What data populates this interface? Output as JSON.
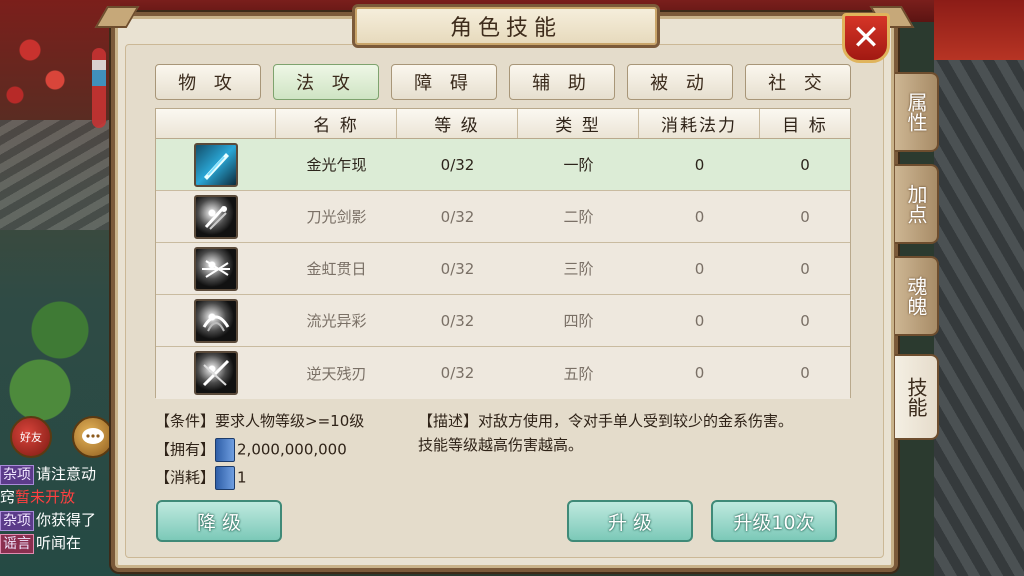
{
  "window": {
    "title": "角色技能",
    "close_icon": "close-x-icon"
  },
  "category_tabs": [
    {
      "label": "物 攻",
      "active": false
    },
    {
      "label": "法 攻",
      "active": true
    },
    {
      "label": "障 碍",
      "active": false
    },
    {
      "label": "辅 助",
      "active": false
    },
    {
      "label": "被 动",
      "active": false
    },
    {
      "label": "社 交",
      "active": false
    }
  ],
  "side_tabs": [
    {
      "label": "属性",
      "active": false
    },
    {
      "label": "加点",
      "active": false
    },
    {
      "label": "魂魄",
      "active": false
    },
    {
      "label": "技能",
      "active": true
    }
  ],
  "table": {
    "headers": [
      "",
      "名 称",
      "等 级",
      "类 型",
      "消耗法力",
      "目 标"
    ],
    "rows": [
      {
        "icon": "golden-light-sword-icon",
        "name": "金光乍现",
        "level": "0/32",
        "type": "一阶",
        "mana": "0",
        "target": "0",
        "selected": true
      },
      {
        "icon": "blade-shadow-icon",
        "name": "刀光剑影",
        "level": "0/32",
        "type": "二阶",
        "mana": "0",
        "target": "0",
        "selected": false
      },
      {
        "icon": "rainbow-sword-icon",
        "name": "金虹贯日",
        "level": "0/32",
        "type": "三阶",
        "mana": "0",
        "target": "0",
        "selected": false
      },
      {
        "icon": "flowing-light-icon",
        "name": "流光异彩",
        "level": "0/32",
        "type": "四阶",
        "mana": "0",
        "target": "0",
        "selected": false
      },
      {
        "icon": "broken-blade-icon",
        "name": "逆天残刃",
        "level": "0/32",
        "type": "五阶",
        "mana": "0",
        "target": "0",
        "selected": false
      }
    ]
  },
  "info": {
    "condition_label": "【条件】",
    "condition_text": "要求人物等级>=10级",
    "own_label": "【拥有】",
    "own_value": "2,000,000,000",
    "cost_label": "【消耗】",
    "cost_value": "1",
    "desc_label": "【描述】",
    "desc_line1": "对敌方使用，令对手单人受到较少的金系伤害。",
    "desc_line2": "技能等级越高伤害越高。"
  },
  "buttons": {
    "downgrade": "降  级",
    "upgrade": "升  级",
    "upgrade_10": "升级10次"
  },
  "chat": {
    "friend_icon_label": "好友",
    "lines": [
      {
        "tag": "杂项",
        "text": "请注意动",
        "red": ""
      },
      {
        "tag": "",
        "text": "窍",
        "red": "暂未开放"
      },
      {
        "tag": "杂项",
        "text": "你获得了",
        "red": ""
      },
      {
        "tag": "谣言",
        "text": "听闻在",
        "red": ""
      }
    ]
  },
  "colors": {
    "panel_bg": "#e9e2d2",
    "selected_row": "#dcecd6",
    "button_teal": "#7cc9b8",
    "close_red": "#c4241a"
  }
}
